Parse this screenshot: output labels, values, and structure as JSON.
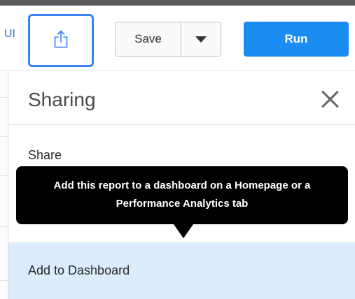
{
  "toolbar": {
    "partial_label": "UI",
    "share_icon": "share-upload-icon",
    "save_label": "Save",
    "save_menu_icon": "caret-down-icon",
    "run_label": "Run",
    "run_color": "#1b8cf2",
    "share_focus_color": "#3b82f6"
  },
  "panel": {
    "title": "Sharing",
    "close_icon": "close-icon",
    "items": [
      {
        "label": "Share"
      },
      {
        "label": "Add to Dashboard",
        "highlighted": true,
        "highlight_color": "#dcecfd"
      }
    ]
  },
  "tooltip": {
    "text": "Add this report to a dashboard on a Homepage or a Performance Analytics tab"
  }
}
